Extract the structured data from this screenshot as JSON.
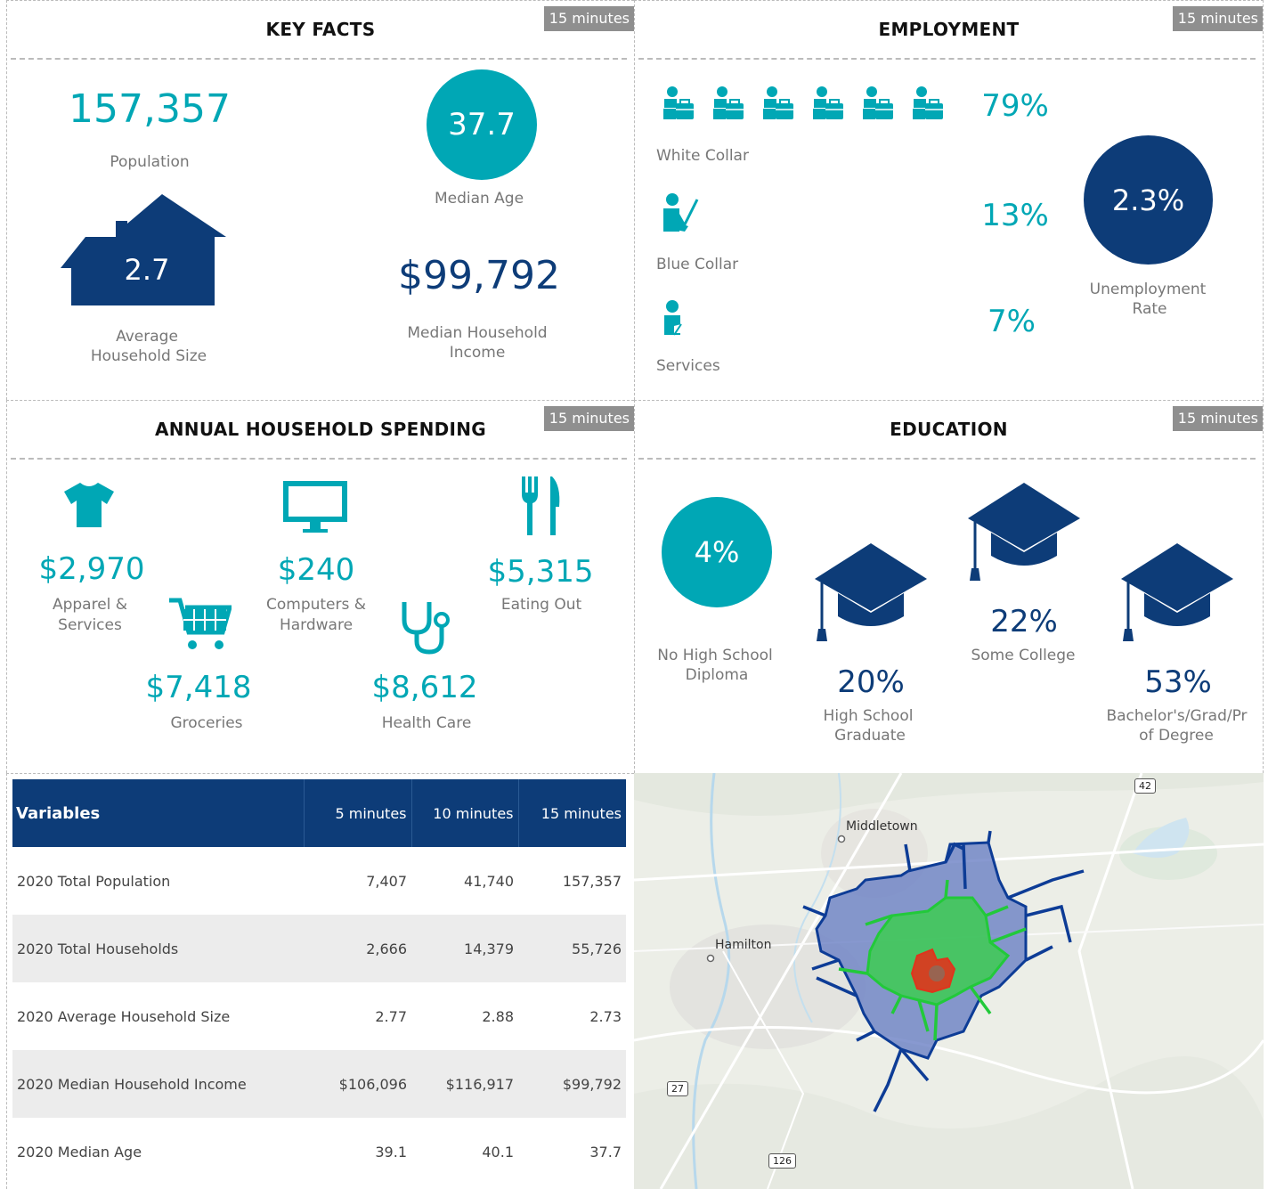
{
  "badge_label": "15 minutes",
  "key_facts": {
    "title": "KEY FACTS",
    "population_value": "157,357",
    "population_label": "Population",
    "median_age_value": "37.7",
    "median_age_label": "Median Age",
    "household_size_value": "2.7",
    "household_size_label_1": "Average",
    "household_size_label_2": "Household Size",
    "income_value": "$99,792",
    "income_label_1": "Median Household",
    "income_label_2": "Income"
  },
  "employment": {
    "title": "EMPLOYMENT",
    "white_collar_pct": "79%",
    "white_collar_label": "White Collar",
    "blue_collar_pct": "13%",
    "blue_collar_label": "Blue Collar",
    "services_pct": "7%",
    "services_label": "Services",
    "unemployment_value": "2.3%",
    "unemployment_label_1": "Unemployment",
    "unemployment_label_2": "Rate"
  },
  "spending": {
    "title": "ANNUAL HOUSEHOLD SPENDING",
    "apparel_value": "$2,970",
    "apparel_label_1": "Apparel &",
    "apparel_label_2": "Services",
    "computers_value": "$240",
    "computers_label_1": "Computers &",
    "computers_label_2": "Hardware",
    "eating_value": "$5,315",
    "eating_label": "Eating Out",
    "groceries_value": "$7,418",
    "groceries_label": "Groceries",
    "health_value": "$8,612",
    "health_label": "Health Care"
  },
  "education": {
    "title": "EDUCATION",
    "no_hs_value": "4%",
    "no_hs_label_1": "No High School",
    "no_hs_label_2": "Diploma",
    "hs_value": "20%",
    "hs_label_1": "High School",
    "hs_label_2": "Graduate",
    "some_college_value": "22%",
    "some_college_label": "Some College",
    "bachelors_value": "53%",
    "bachelors_label_1": "Bachelor's/Grad/Pr",
    "bachelors_label_2": "of Degree"
  },
  "table": {
    "headers": [
      "Variables",
      "5 minutes",
      "10 minutes",
      "15 minutes"
    ],
    "rows": [
      [
        "2020 Total Population",
        "7,407",
        "41,740",
        "157,357"
      ],
      [
        "2020 Total Households",
        "2,666",
        "14,379",
        "55,726"
      ],
      [
        "2020 Average Household Size",
        "2.77",
        "2.88",
        "2.73"
      ],
      [
        "2020 Median Household Income",
        "$106,096",
        "$116,917",
        "$99,792"
      ],
      [
        "2020 Median Age",
        "39.1",
        "40.1",
        "37.7"
      ]
    ]
  },
  "map": {
    "labels": {
      "middletown": "Middletown",
      "hamilton": "Hamilton"
    },
    "shields": {
      "r42": "42",
      "r27": "27",
      "r126": "126"
    },
    "colors": {
      "fifteen_min": "#0d3c96",
      "ten_min": "#22c93a",
      "five_min": "#e0341c"
    }
  },
  "colors": {
    "teal": "#00a7b5",
    "navy": "#0d3c78",
    "badge": "#8f8f8f"
  }
}
